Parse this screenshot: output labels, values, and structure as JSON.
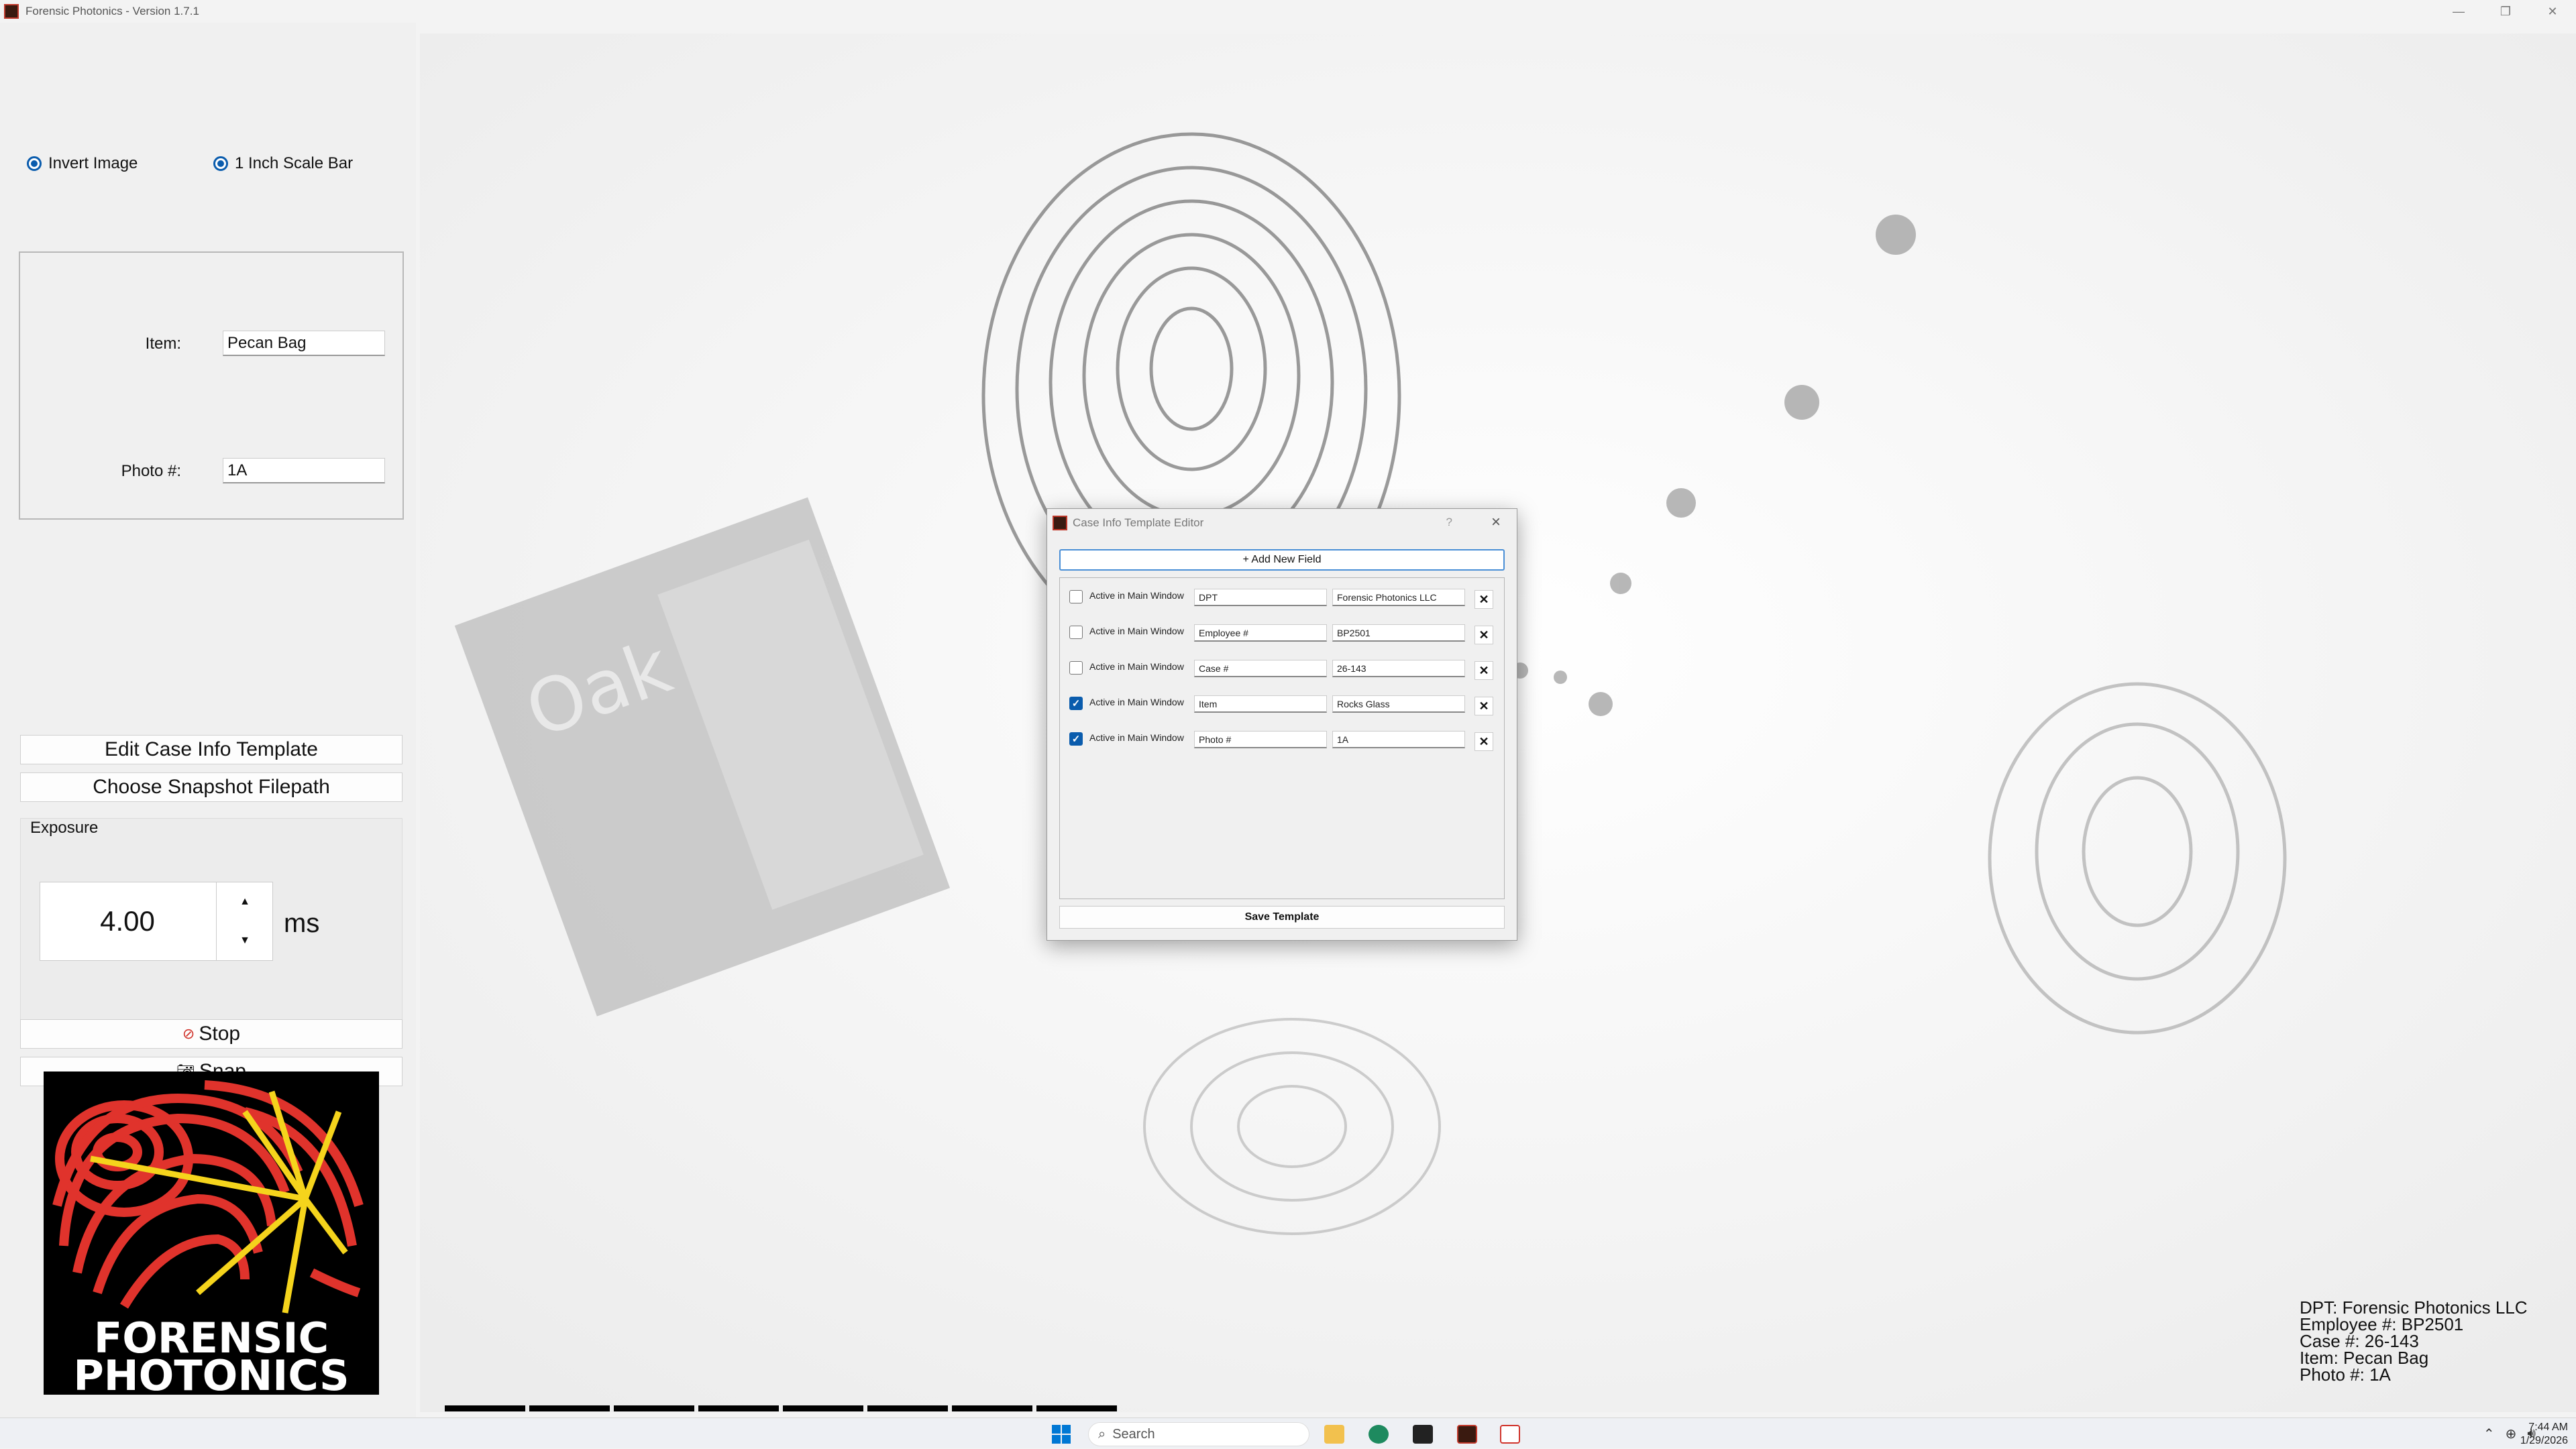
{
  "window": {
    "title": "Forensic Photonics - Version 1.7.1"
  },
  "options": {
    "invert_label": "Invert Image",
    "scale_label": "1 Inch Scale Bar"
  },
  "case_info": {
    "item_label": "Item:",
    "item_value": "Pecan Bag",
    "photo_label": "Photo #:",
    "photo_value": "1A"
  },
  "buttons": {
    "edit_template": "Edit Case Info Template",
    "choose_path": "Choose Snapshot Filepath",
    "stop": "Stop",
    "snap": "Snap"
  },
  "exposure": {
    "legend": "Exposure",
    "value": "4.00",
    "unit": "ms"
  },
  "logo": {
    "line1": "FORENSIC",
    "line2": "PHOTONICS"
  },
  "overlay": [
    "DPT: Forensic Photonics LLC",
    "Employee #: BP2501",
    "Case #: 26-143",
    "Item: Pecan Bag",
    "Photo #: 1A"
  ],
  "dialog": {
    "title": "Case Info Template Editor",
    "help": "?",
    "add_field": "+ Add New Field",
    "save": "Save Template",
    "rows": [
      {
        "checked": false,
        "label": "Active in Main Window",
        "name": "DPT",
        "value": "Forensic Photonics LLC"
      },
      {
        "checked": false,
        "label": "Active in Main Window",
        "name": "Employee #",
        "value": "BP2501"
      },
      {
        "checked": false,
        "label": "Active in Main Window",
        "name": "Case #",
        "value": "26-143"
      },
      {
        "checked": true,
        "label": "Active in Main Window",
        "name": "Item",
        "value": "Rocks Glass"
      },
      {
        "checked": true,
        "label": "Active in Main Window",
        "name": "Photo #",
        "value": "1A"
      }
    ]
  },
  "taskbar": {
    "search_placeholder": "Search",
    "time": "7:44 AM",
    "date": "1/29/2026"
  },
  "colors": {
    "accent": "#0a5cad",
    "logo_red": "#e0332c",
    "logo_yellow": "#f5d41c"
  }
}
